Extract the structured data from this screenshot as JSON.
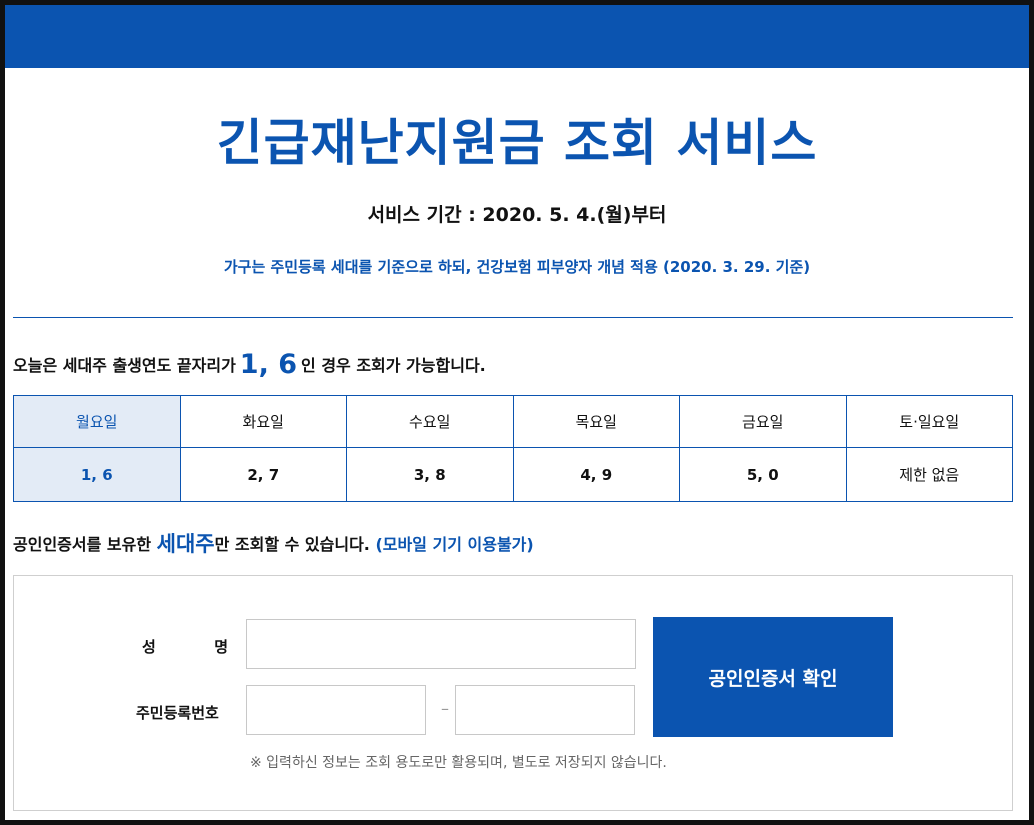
{
  "header": {
    "title": "긴급재난지원금 조회 서비스",
    "period": "서비스 기간 : 2020. 5. 4.(월)부터",
    "notice": "가구는 주민등록 세대를 기준으로 하되, 건강보험 피부양자 개념 적용 (2020. 3. 29. 기준)"
  },
  "today": {
    "prefix": "오늘은 세대주 출생연도 끝자리가",
    "digits": "1, 6",
    "suffix": "인 경우 조회가 가능합니다."
  },
  "schedule": {
    "days": [
      "월요일",
      "화요일",
      "수요일",
      "목요일",
      "금요일",
      "토·일요일"
    ],
    "digits": [
      "1, 6",
      "2, 7",
      "3, 8",
      "4, 9",
      "5, 0",
      "제한 없음"
    ],
    "active_index": 0
  },
  "cert_note": {
    "prefix": "공인인증서를 보유한",
    "highlight": "세대주",
    "middle": "만 조회할 수 있습니다.",
    "mobile": "(모바일 기기 이용불가)"
  },
  "form": {
    "name_label_1": "성",
    "name_label_2": "명",
    "name_value": "",
    "rrn_label": "주민등록번호",
    "rrn_front_value": "",
    "rrn_back_value": "",
    "separator": "–",
    "submit_label": "공인인증서 확인",
    "privacy_note": "※ 입력하신 정보는 조회 용도로만 활용되며, 별도로 저장되지 않습니다."
  },
  "colors": {
    "brand": "#0b54b0",
    "active_cell_bg": "#e3ebf6"
  }
}
